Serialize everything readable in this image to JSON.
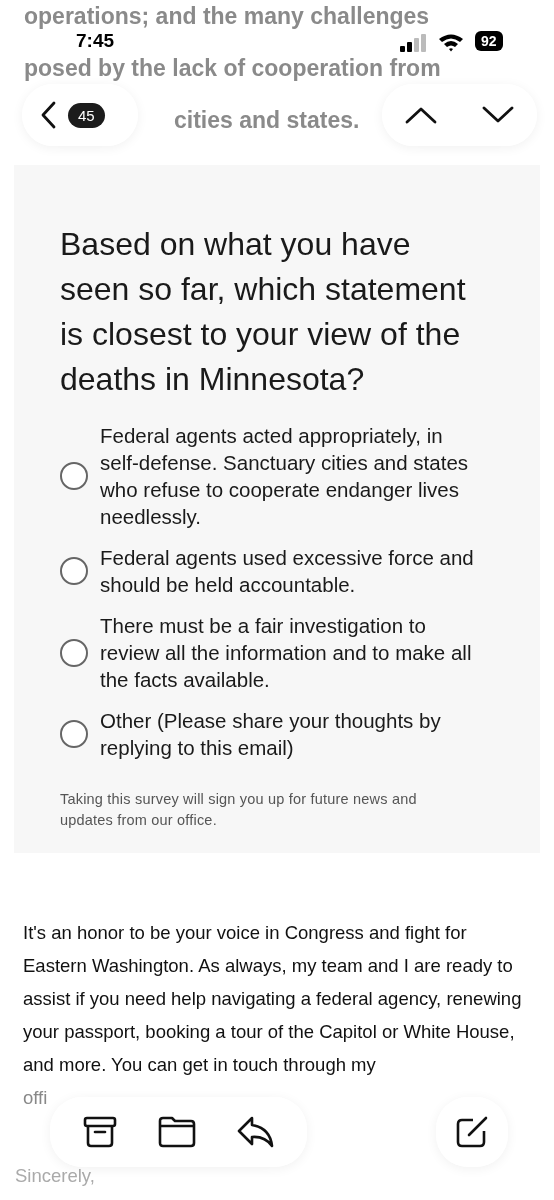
{
  "status_bar": {
    "time": "7:45",
    "battery": "92"
  },
  "background_text": [
    "operations; and the many challenges",
    "posed by the lack of cooperation from",
    "cities and states."
  ],
  "nav": {
    "back_count": "45"
  },
  "survey": {
    "question": "Based on what you have seen so far, which statement is closest to your view of the deaths in Minnesota?",
    "options": [
      {
        "label": "Federal agents acted appropriately, in self-defense. Sanctuary cities and states who refuse to cooperate endanger lives needlessly.",
        "selected": false
      },
      {
        "label": "Federal agents used excessive force and should be held accountable.",
        "selected": false
      },
      {
        "label": "There must be a fair investigation to review all the information and to make all the facts available.",
        "selected": false
      },
      {
        "label": "Other (Please share your thoughts by replying to this email)",
        "selected": false
      }
    ],
    "note": "Taking this survey will sign you up for future news and updates from our office."
  },
  "body": {
    "paragraph": "It's an honor to be your voice in Congress and fight for Eastern Washington. As always, my team and I are ready to assist if you need help navigating a federal agency, renewing your passport, booking a tour of the Capitol or White House, and more. You can get in touch through my",
    "cut_text": "offi",
    "closing": "Sincerely,"
  }
}
